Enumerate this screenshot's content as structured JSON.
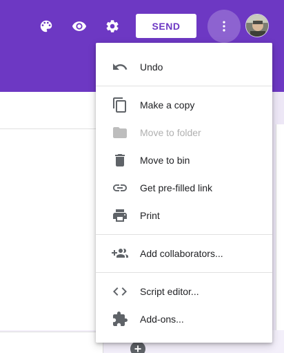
{
  "toolbar": {
    "send_label": "SEND",
    "icons": {
      "palette": "palette-icon",
      "preview": "eye-icon",
      "settings": "gear-icon",
      "more": "more-vert-icon"
    }
  },
  "colors": {
    "header": "#6d38c3",
    "page_bg": "#ede7f6",
    "icon_gray": "#5f6368",
    "disabled_gray": "#b0b0b0"
  },
  "menu": {
    "undo": "Undo",
    "make_copy": "Make a copy",
    "move_to_folder": "Move to folder",
    "move_to_bin": "Move to bin",
    "prefilled_link": "Get pre-filled link",
    "print": "Print",
    "add_collaborators": "Add collaborators...",
    "script_editor": "Script editor...",
    "add_ons": "Add-ons..."
  }
}
